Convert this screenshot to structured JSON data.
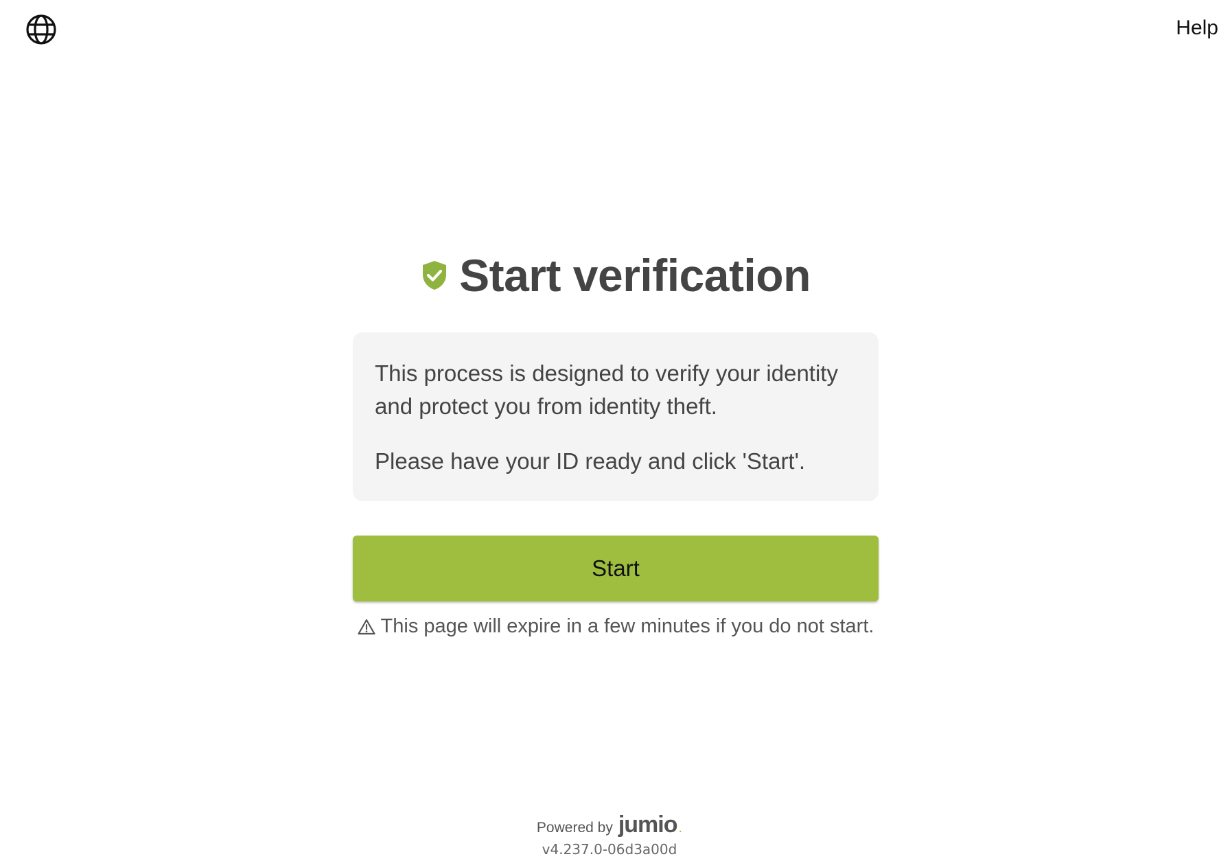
{
  "header": {
    "language_icon": "globe-icon",
    "help_label": "Help"
  },
  "main": {
    "title_icon": "shield-check-icon",
    "title": "Start verification",
    "info_paragraph_1": "This process is designed to verify your identity and protect you from identity theft.",
    "info_paragraph_2": "Please have your ID ready and click 'Start'.",
    "start_button_label": "Start",
    "warning_icon": "warning-triangle-icon",
    "expire_notice": "This page will expire in a few minutes if you do not start."
  },
  "footer": {
    "powered_by": "Powered by",
    "brand": "jumio",
    "brand_dot": ".",
    "version": "v4.237.0-06d3a00d"
  },
  "colors": {
    "accent_green": "#9fbd3f",
    "text_primary": "#444444",
    "info_box_bg": "#f4f4f4"
  }
}
